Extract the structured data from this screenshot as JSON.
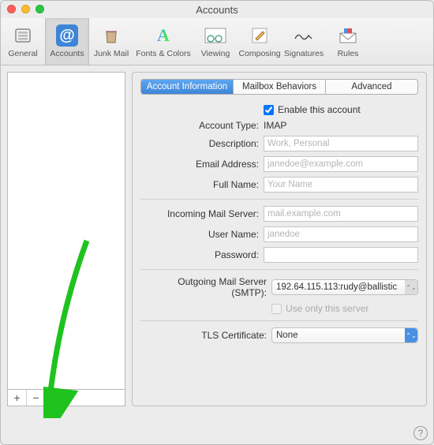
{
  "window": {
    "title": "Accounts"
  },
  "toolbar": [
    {
      "id": "general",
      "label": "General",
      "glyph": "◻"
    },
    {
      "id": "accounts",
      "label": "Accounts",
      "glyph": "@",
      "selected": true
    },
    {
      "id": "junk",
      "label": "Junk Mail",
      "glyph": "🗑"
    },
    {
      "id": "fonts",
      "label": "Fonts & Colors",
      "glyph": "A"
    },
    {
      "id": "viewing",
      "label": "Viewing",
      "glyph": "👓"
    },
    {
      "id": "composing",
      "label": "Composing",
      "glyph": "✎"
    },
    {
      "id": "signatures",
      "label": "Signatures",
      "glyph": "✒"
    },
    {
      "id": "rules",
      "label": "Rules",
      "glyph": "✉"
    }
  ],
  "sidebar": {
    "add": "+",
    "remove": "−"
  },
  "tabs": {
    "info": "Account Information",
    "mailbox": "Mailbox Behaviors",
    "advanced": "Advanced"
  },
  "form": {
    "enable_label": "Enable this account",
    "enable_checked": true,
    "account_type_label": "Account Type:",
    "account_type_value": "IMAP",
    "description_label": "Description:",
    "description_placeholder": "Work, Personal",
    "email_label": "Email Address:",
    "email_placeholder": "janedoe@example.com",
    "fullname_label": "Full Name:",
    "fullname_placeholder": "Your Name",
    "incoming_label": "Incoming Mail Server:",
    "incoming_placeholder": "mail.example.com",
    "username_label": "User Name:",
    "username_placeholder": "janedoe",
    "password_label": "Password:",
    "smtp_label": "Outgoing Mail Server (SMTP):",
    "smtp_value": "192.64.115.113:rudy@ballistic",
    "use_only_label": "Use only this server",
    "tls_label": "TLS Certificate:",
    "tls_value": "None"
  },
  "help": "?"
}
